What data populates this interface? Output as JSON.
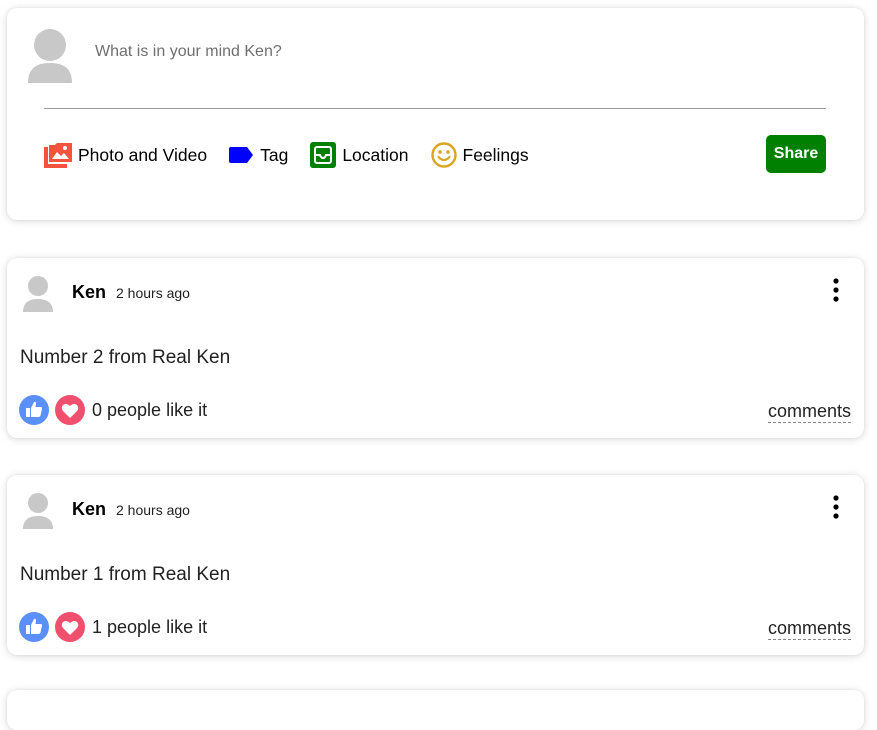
{
  "share": {
    "placeholder": "What is in your mind Ken?",
    "options": [
      {
        "label": "Photo and Video",
        "icon": "photo-video-icon",
        "color": "#f5533d"
      },
      {
        "label": "Tag",
        "icon": "tag-icon",
        "color": "#0000ff"
      },
      {
        "label": "Location",
        "icon": "location-icon",
        "color": "#008000"
      },
      {
        "label": "Feelings",
        "icon": "feelings-icon",
        "color": "#daa520"
      }
    ],
    "button_label": "Share",
    "button_color": "#008000"
  },
  "posts": [
    {
      "username": "Ken",
      "time": "2 hours ago",
      "text": "Number 2 from Real Ken",
      "likes": "0 people like it",
      "comments_label": "comments"
    },
    {
      "username": "Ken",
      "time": "2 hours ago",
      "text": "Number 1 from Real Ken",
      "likes": "1 people like it",
      "comments_label": "comments"
    }
  ],
  "colors": {
    "like": "#5b8ff9",
    "heart": "#f0506e",
    "avatar": "#c8c8c8"
  }
}
